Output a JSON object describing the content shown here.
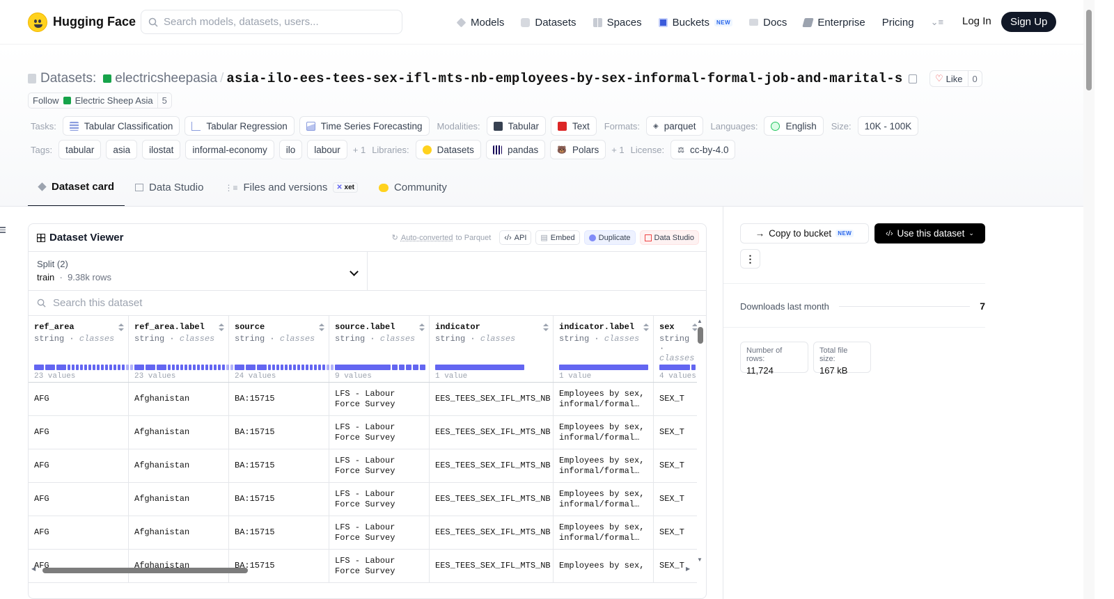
{
  "header": {
    "brand": "Hugging Face",
    "search_placeholder": "Search models, datasets, users...",
    "nav": [
      {
        "label": "Models",
        "icon": "models-icon"
      },
      {
        "label": "Datasets",
        "icon": "datasets-icon"
      },
      {
        "label": "Spaces",
        "icon": "spaces-icon"
      },
      {
        "label": "Buckets",
        "icon": "buckets-icon",
        "badge": "NEW"
      },
      {
        "label": "Docs",
        "icon": "docs-icon"
      },
      {
        "label": "Enterprise",
        "icon": "enterprise-icon"
      },
      {
        "label": "Pricing"
      }
    ],
    "login": "Log In",
    "signup": "Sign Up"
  },
  "repo": {
    "type_label": "Datasets:",
    "org": "electricsheepasia",
    "name": "asia-ilo-ees-tees-sex-ifl-mts-nb-employees-by-sex-informal-formal-job-and-marital-s",
    "like_label": "Like",
    "like_count": "0",
    "follow_label": "Follow",
    "follow_org": "Electric Sheep Asia",
    "follow_count": "5"
  },
  "meta": {
    "tasks_label": "Tasks:",
    "tasks": [
      "Tabular Classification",
      "Tabular Regression",
      "Time Series Forecasting"
    ],
    "modalities_label": "Modalities:",
    "modalities": [
      "Tabular",
      "Text"
    ],
    "formats_label": "Formats:",
    "formats": [
      "parquet"
    ],
    "languages_label": "Languages:",
    "languages": [
      "English"
    ],
    "size_label": "Size:",
    "size": "10K - 100K",
    "tags_label": "Tags:",
    "tags": [
      "tabular",
      "asia",
      "ilostat",
      "informal-economy",
      "ilo",
      "labour"
    ],
    "tags_more": "+ 1",
    "libraries_label": "Libraries:",
    "libraries": [
      "Datasets",
      "pandas",
      "Polars"
    ],
    "libraries_more": "+ 1",
    "license_label": "License:",
    "license": "cc-by-4.0"
  },
  "tabs": [
    {
      "label": "Dataset card",
      "active": true
    },
    {
      "label": "Data Studio"
    },
    {
      "label": "Files and versions",
      "badge": "xet"
    },
    {
      "label": "Community"
    }
  ],
  "viewer": {
    "title": "Dataset Viewer",
    "auto_converted_link": "Auto-converted",
    "auto_converted_rest": " to Parquet",
    "tools": [
      "API",
      "Embed",
      "Duplicate",
      "Data Studio"
    ],
    "split_label": "Split (2)",
    "split_value": "train",
    "split_rows": "9.38k rows",
    "search_placeholder": "Search this dataset",
    "columns": [
      {
        "name": "ref_area",
        "type": "string",
        "kind": "classes",
        "values": "23 values"
      },
      {
        "name": "ref_area.label",
        "type": "string",
        "kind": "classes",
        "values": "23 values"
      },
      {
        "name": "source",
        "type": "string",
        "kind": "classes",
        "values": "24 values"
      },
      {
        "name": "source.label",
        "type": "string",
        "kind": "classes",
        "values": "9 values"
      },
      {
        "name": "indicator",
        "type": "string",
        "kind": "classes",
        "values": "1 value"
      },
      {
        "name": "indicator.label",
        "type": "string",
        "kind": "classes",
        "values": "1 value"
      },
      {
        "name": "sex",
        "type": "string",
        "kind": "classes",
        "values": "4 values"
      }
    ],
    "rows": [
      [
        "AFG",
        "Afghanistan",
        "BA:15715",
        "LFS - Labour Force Survey",
        "EES_TEES_SEX_IFL_MTS_NB",
        "Employees by sex, informal/formal…",
        "SEX_T"
      ],
      [
        "AFG",
        "Afghanistan",
        "BA:15715",
        "LFS - Labour Force Survey",
        "EES_TEES_SEX_IFL_MTS_NB",
        "Employees by sex, informal/formal…",
        "SEX_T"
      ],
      [
        "AFG",
        "Afghanistan",
        "BA:15715",
        "LFS - Labour Force Survey",
        "EES_TEES_SEX_IFL_MTS_NB",
        "Employees by sex, informal/formal…",
        "SEX_T"
      ],
      [
        "AFG",
        "Afghanistan",
        "BA:15715",
        "LFS - Labour Force Survey",
        "EES_TEES_SEX_IFL_MTS_NB",
        "Employees by sex, informal/formal…",
        "SEX_T"
      ],
      [
        "AFG",
        "Afghanistan",
        "BA:15715",
        "LFS - Labour Force Survey",
        "EES_TEES_SEX_IFL_MTS_NB",
        "Employees by sex, informal/formal…",
        "SEX_T"
      ],
      [
        "AFG",
        "Afghanistan",
        "BA:15715",
        "LFS - Labour Force Survey",
        "EES_TEES_SEX_IFL_MTS_NB",
        "Employees by sex,",
        "SEX_T"
      ]
    ]
  },
  "sidebar": {
    "copy_to_bucket": "Copy to bucket",
    "copy_badge": "NEW",
    "use_dataset": "Use this dataset",
    "downloads_label": "Downloads last month",
    "downloads_value": "7",
    "rows_label": "Number of rows:",
    "rows_value": "11,724",
    "size_label": "Total file size:",
    "size_value": "167 kB"
  },
  "colors": {
    "accent": "#6366f1",
    "brand_yellow": "#FFD21E",
    "dark": "#111827"
  }
}
